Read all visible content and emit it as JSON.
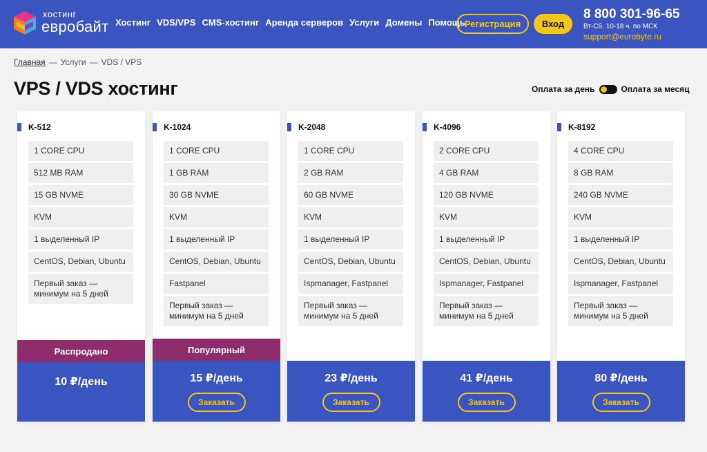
{
  "header": {
    "logo_small": "хостинг",
    "logo_big": "евробайт",
    "nav": [
      "Хостинг",
      "VDS/VPS",
      "CMS-хостинг",
      "Аренда серверов",
      "Услуги",
      "Домены",
      "Помощь"
    ],
    "register_label": "Регистрация",
    "login_label": "Вход",
    "phone": "8 800 301-96-65",
    "hours": "Вт-Сб. 10-18 ч. по МСК",
    "email": "support@eurobyte.ru",
    "accent_color": "#3a55bf",
    "highlight_color": "#f5c518"
  },
  "breadcrumbs": {
    "home": "Главная",
    "sep": "—",
    "services": "Услуги",
    "current": "VDS / VPS"
  },
  "page_title": "VPS / VDS хостинг",
  "payment_toggle": {
    "daily_label": "Оплата за день",
    "monthly_label": "Оплата за месяц"
  },
  "plans": [
    {
      "name": "K-512",
      "features": [
        "1 CORE CPU",
        "512 MB RAM",
        "15 GB NVME",
        "KVM",
        "1 выделенный IP",
        "CentOS, Debian, Ubuntu",
        "Первый заказ — минимум на 5 дней"
      ],
      "badge": "Распродано",
      "price": "10 ₽/день",
      "order_label": ""
    },
    {
      "name": "K-1024",
      "features": [
        "1 CORE CPU",
        "1 GB RAM",
        "30 GB NVME",
        "KVM",
        "1 выделенный IP",
        "CentOS, Debian, Ubuntu",
        "Fastpanel",
        "Первый заказ — минимум на 5 дней"
      ],
      "badge": "Популярный",
      "price": "15 ₽/день",
      "order_label": "Заказать"
    },
    {
      "name": "K-2048",
      "features": [
        "1 CORE CPU",
        "2 GB RAM",
        "60 GB NVME",
        "KVM",
        "1 выделенный IP",
        "CentOS, Debian, Ubuntu",
        "Ispmanager, Fastpanel",
        "Первый заказ — минимум на 5 дней"
      ],
      "badge": "",
      "price": "23 ₽/день",
      "order_label": "Заказать"
    },
    {
      "name": "K-4096",
      "features": [
        "2 CORE CPU",
        "4 GB RAM",
        "120 GB NVME",
        "KVM",
        "1 выделенный IP",
        "CentOS, Debian, Ubuntu",
        "Ispmanager, Fastpanel",
        "Первый заказ — минимум на 5 дней"
      ],
      "badge": "",
      "price": "41 ₽/день",
      "order_label": "Заказать"
    },
    {
      "name": "K-8192",
      "features": [
        "4 CORE CPU",
        "8 GB RAM",
        "240 GB NVME",
        "KVM",
        "1 выделенный IP",
        "CentOS, Debian, Ubuntu",
        "Ispmanager, Fastpanel",
        "Первый заказ — минимум на 5 дней"
      ],
      "badge": "",
      "price": "80 ₽/день",
      "order_label": "Заказать"
    }
  ],
  "badge_color": "#8e2c6c"
}
